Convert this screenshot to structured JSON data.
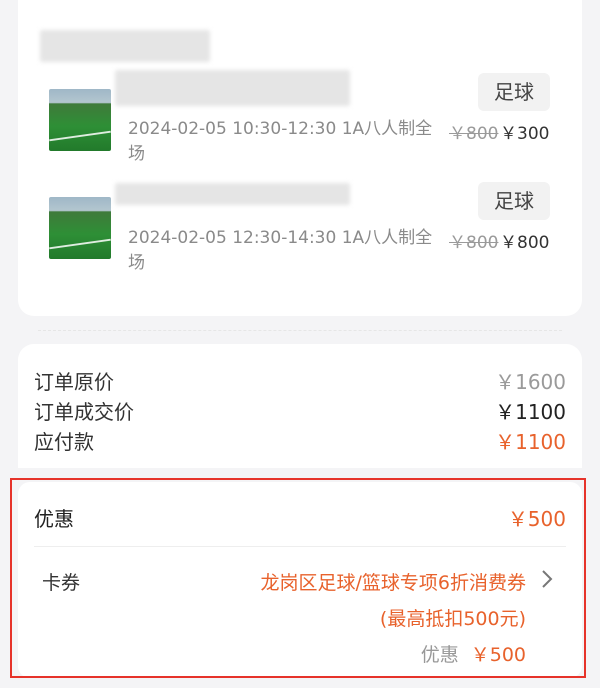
{
  "orders": [
    {
      "tag": "足球",
      "slot": "2024-02-05 10:30-12:30 1A八人制全场",
      "original_price": "￥800",
      "price": "￥300"
    },
    {
      "tag": "足球",
      "slot": "2024-02-05 12:30-14:30 1A八人制全场",
      "original_price": "￥800",
      "price": "￥800"
    }
  ],
  "summary": {
    "original_label": "订单原价",
    "original_value": "￥1600",
    "deal_label": "订单成交价",
    "deal_value": "￥1100",
    "payable_label": "应付款",
    "payable_value": "￥1100"
  },
  "discount": {
    "label": "优惠",
    "value": "￥500",
    "coupon_label": "卡券",
    "coupon_name": "龙岗区足球/篮球专项6折消费券",
    "coupon_note": "(最高抵扣500元)",
    "coupon_discount_label": "优惠",
    "coupon_discount_value": "￥500"
  },
  "colors": {
    "accent": "#e8622c",
    "highlight_border": "#e6332a",
    "background": "#f4f4f6"
  },
  "icons": {
    "coupon_arrow": "chevron-right-icon"
  }
}
